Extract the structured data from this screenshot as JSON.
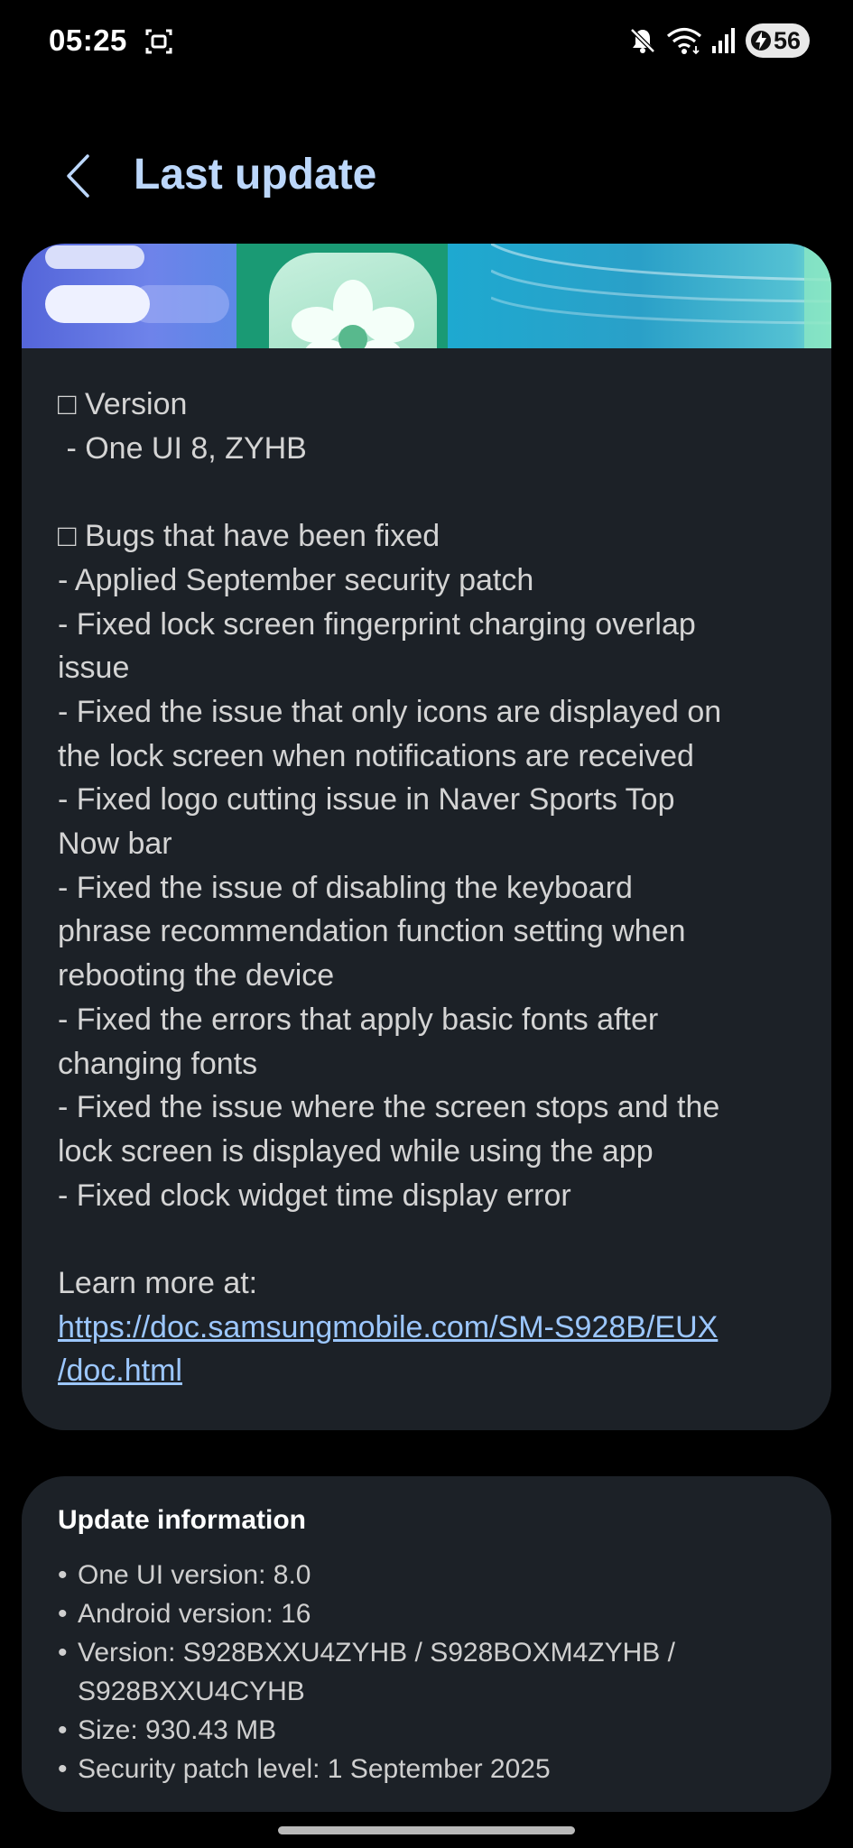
{
  "status_bar": {
    "time": "05:25",
    "battery_level": "56",
    "icons": [
      "screenshot-icon",
      "mute-icon",
      "wifi-icon",
      "signal-icon",
      "battery-charging-icon"
    ]
  },
  "header": {
    "back_icon": "chevron-left-icon",
    "title": "Last update"
  },
  "update_notes": {
    "lines": [
      "□ Version",
      " - One UI 8, ZYHB",
      "",
      "□ Bugs that have been fixed",
      "- Applied September security patch",
      "- Fixed lock screen fingerprint charging overlap",
      "issue",
      "- Fixed the issue that only icons are displayed on",
      "the lock screen when notifications are received",
      "- Fixed logo cutting issue in Naver Sports Top",
      "Now bar",
      "- Fixed the issue of disabling the keyboard",
      "phrase recommendation function setting when",
      "rebooting the device",
      "- Fixed the errors that apply basic fonts after",
      "changing fonts",
      "- Fixed the issue where the screen stops and the",
      "lock screen is displayed while using the app",
      "- Fixed clock widget time display error",
      "",
      "Learn more at:"
    ],
    "link_lines": [
      "https://doc.samsungmobile.com/SM-S928B/EUX",
      "/doc.html"
    ]
  },
  "update_info": {
    "title": "Update information",
    "items": [
      {
        "bullet": "•",
        "lines": [
          "One UI version: 8.0"
        ]
      },
      {
        "bullet": "•",
        "lines": [
          "Android version: 16"
        ]
      },
      {
        "bullet": "•",
        "lines": [
          "Version: S928BXXU4ZYHB / S928BOXM4ZYHB /",
          "S928BXXU4CYHB"
        ]
      },
      {
        "bullet": "•",
        "lines": [
          "Size: 930.43 MB"
        ]
      },
      {
        "bullet": "•",
        "lines": [
          "Security patch level: 1 September 2025"
        ]
      }
    ]
  },
  "colors": {
    "background": "#000000",
    "card": "#1c2127",
    "title": "#bcd7fb",
    "link": "#9cc7ff",
    "body_text": "#d4d4d4"
  }
}
